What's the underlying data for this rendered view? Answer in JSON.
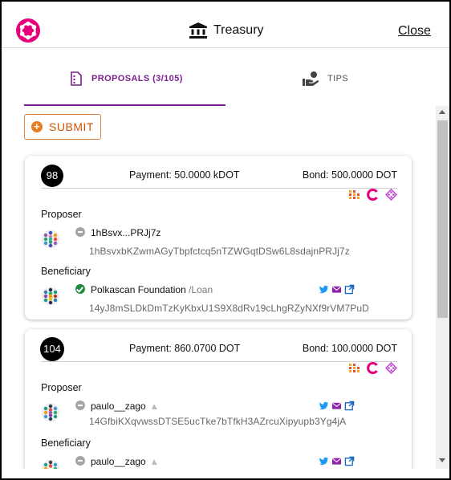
{
  "header": {
    "title": "Treasury",
    "close_label": "Close",
    "brand_color": "#e6007a"
  },
  "tabs": [
    {
      "label": "PROPOSALS (3/105)",
      "active": true,
      "icon": "document-icon"
    },
    {
      "label": "TIPS",
      "active": false,
      "icon": "hand-coin-icon"
    }
  ],
  "actions": {
    "submit_label": "SUBMIT"
  },
  "proposals": [
    {
      "number": "98",
      "payment": "Payment: 50.0000 kDOT",
      "bond": "Bond: 500.0000 DOT",
      "proposer_label": "Proposer",
      "proposer": {
        "name": "1hBsvx...PRJj7z",
        "address": "1hBsvxbKZwmAGyTbpfctcq5nTZWGqtDSw6L8sdajnPRJj7z",
        "verified": false
      },
      "beneficiary_label": "Beneficiary",
      "beneficiary": {
        "name": "Polkascan Foundation",
        "sub": " /Loan",
        "address": "14yJ8mSLDkDmTzKyKbxU1S9X8dRv19cLhgRZyNXf9rVM7PuD",
        "verified": true,
        "social": [
          "twitter-icon",
          "email-icon",
          "external-link-icon"
        ]
      }
    },
    {
      "number": "104",
      "payment": "Payment: 860.0700 DOT",
      "bond": "Bond: 100.0000 DOT",
      "proposer_label": "Proposer",
      "proposer": {
        "name": "paulo__zago",
        "address": "14GfbiKXqvwssDTSE5ucTke7bTfkH3AZrcuXipyupb3Yg4jA",
        "verified": false,
        "social": [
          "twitter-icon",
          "email-icon",
          "external-link-icon"
        ]
      },
      "beneficiary_label": "Beneficiary",
      "beneficiary": {
        "name": "paulo__zago",
        "verified": false,
        "social": [
          "twitter-icon",
          "email-icon",
          "external-link-icon"
        ]
      }
    }
  ],
  "colors": {
    "accent": "#7c1f8e",
    "submit": "#d35400",
    "twitter": "#1d9bf0",
    "email": "#8e24aa",
    "link": "#1565c0",
    "verified": "#1f8a3b"
  }
}
